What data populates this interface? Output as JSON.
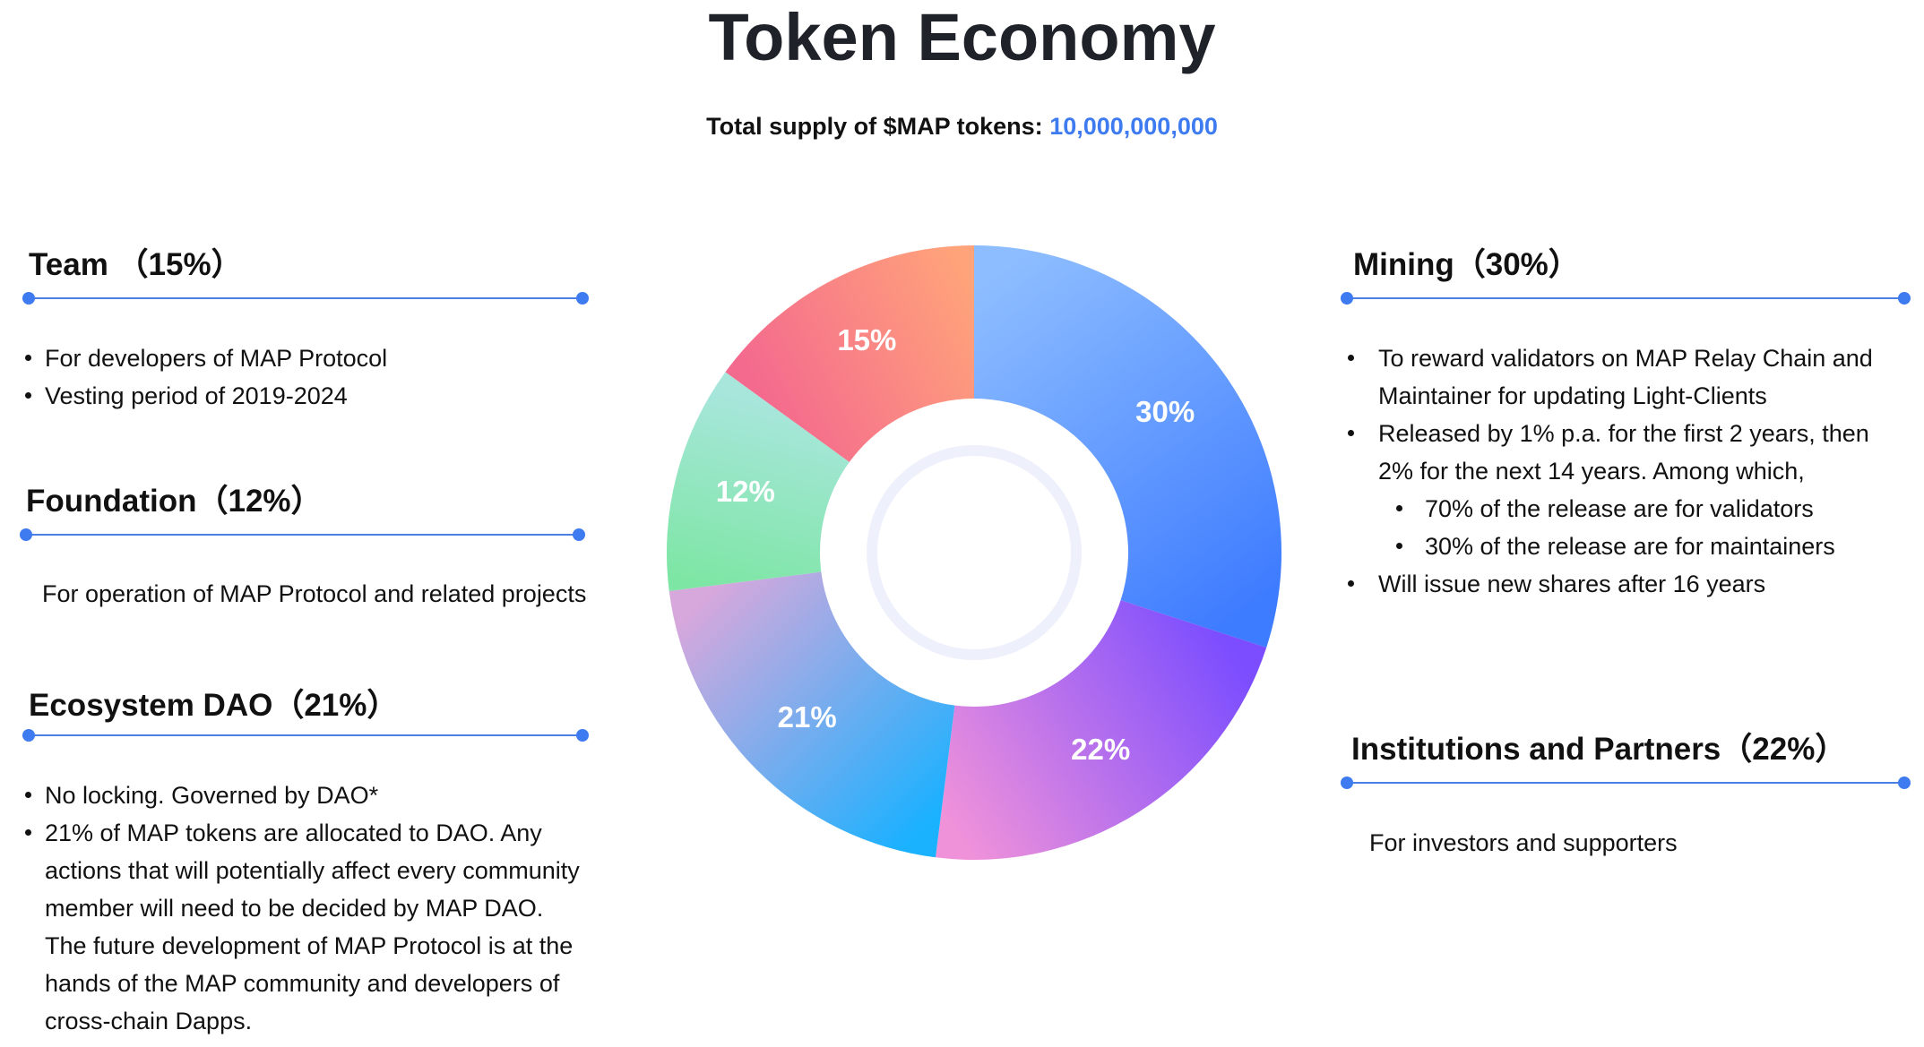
{
  "title": "Token Economy",
  "supply": {
    "label": "Total supply of $MAP tokens:",
    "value": "10,000,000,000"
  },
  "sections": {
    "team": {
      "title": "Team （15%）",
      "bullets": [
        "For developers of MAP Protocol",
        "Vesting period of 2019-2024"
      ]
    },
    "foundation": {
      "title": "Foundation（12%）",
      "text": "For operation of MAP Protocol and related projects"
    },
    "ecosystem": {
      "title": "Ecosystem DAO（21%）",
      "bullets": [
        "No locking. Governed by DAO*",
        "21% of MAP tokens are allocated to DAO. Any",
        "actions that will potentially affect every community",
        "member will need to be decided by MAP DAO.",
        "The future development of MAP Protocol is at the",
        "hands of the MAP community and developers of",
        "cross-chain Dapps."
      ]
    },
    "mining": {
      "title": "Mining（30%）",
      "bullets": [
        "To reward validators on MAP Relay Chain and",
        "Maintainer for updating Light-Clients",
        "Released by 1% p.a. for the first 2 years, then",
        "2% for the next 14 years. Among which,",
        "70% of the release are for validators",
        "30% of the release are for maintainers",
        "Will issue new shares after 16 years"
      ]
    },
    "institutions": {
      "title": "Institutions and Partners（22%）",
      "text": "For investors and supporters"
    }
  },
  "chart_data": {
    "type": "pie",
    "donut": true,
    "categories": [
      "Mining",
      "Institutions and Partners",
      "Ecosystem DAO",
      "Foundation",
      "Team"
    ],
    "values": [
      30,
      22,
      21,
      12,
      15
    ],
    "labels": [
      "30%",
      "22%",
      "21%",
      "12%",
      "15%"
    ],
    "start_angle_deg": 0,
    "direction": "clockwise",
    "colors": [
      [
        "#8dbdff",
        "#3d7bff"
      ],
      [
        "#7b4dff",
        "#f092da"
      ],
      [
        "#1ab1ff",
        "#d7a8dc"
      ],
      [
        "#7ee6a5",
        "#a8e6dc"
      ],
      [
        "#f46a8e",
        "#ffa37a"
      ]
    ]
  }
}
